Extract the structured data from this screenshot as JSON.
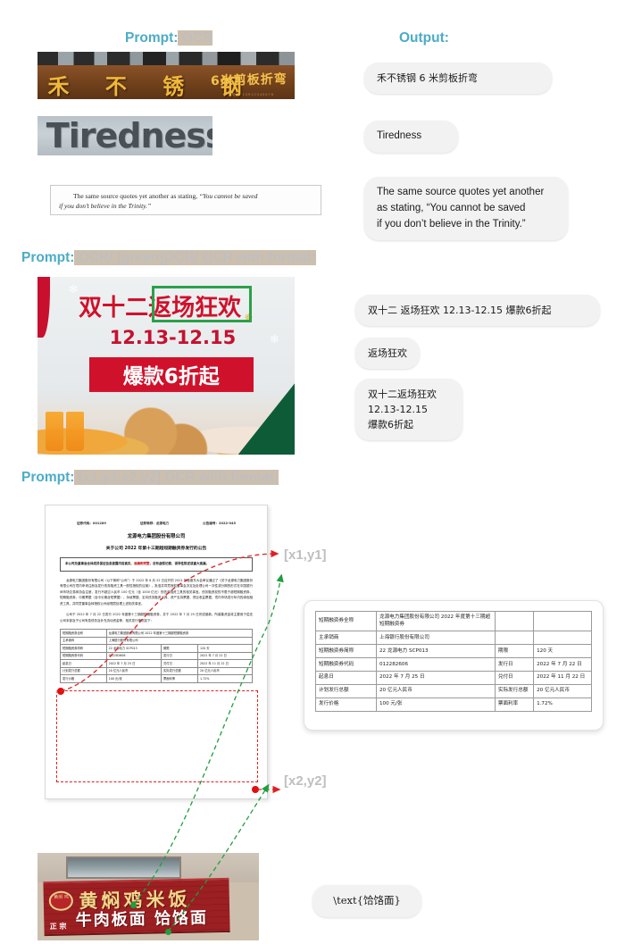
{
  "sections": [
    {
      "id": "section-1",
      "prompt_keyword": "Prompt:",
      "prompt_rest": " OCR",
      "output_heading": "Output:",
      "outputs": [
        {
          "text": "禾不锈钢 6 米剪板折弯"
        },
        {
          "text": "Tiredness"
        },
        {
          "text": "The same source quotes yet another\nas stating, “You cannot be saved\nif you don’t believe in the Trinity.”"
        }
      ],
      "images": [
        {
          "name": "stainless-steel-sign",
          "big_text": "禾 不 锈 钢",
          "small_text": "6米剪板折弯",
          "tiny_text": "电话 13912345678"
        },
        {
          "name": "tiredness-sign",
          "word": "Tiredness"
        },
        {
          "name": "scanned-paragraph",
          "line1_plain": "The same source quotes yet another as stating, ",
          "line1_italic": "“You cannot be saved",
          "line2_italic": "if you don’t believe in the Trinity.”"
        }
      ]
    },
    {
      "id": "section-2",
      "prompt_keyword": "Prompt:",
      "prompt_rest": " OCR/ [green]OCR/ OCR with format:",
      "outputs": [
        {
          "text": "双十二 返场狂欢 12.13-12.15 爆款6折起"
        },
        {
          "text": "返场狂欢"
        },
        {
          "text": "双十二返场狂欢\n12.13-12.15\n爆款6折起"
        }
      ],
      "promo": {
        "name": "kfc-promo-banner",
        "line1": "双十二返场狂欢",
        "line1_highlight": "返场狂欢",
        "line2": "12.13-12.15",
        "line3": "爆款6折起",
        "green_box_color": "#2aa14a",
        "red_color": "#d0112b"
      }
    },
    {
      "id": "section-3",
      "prompt_keyword": "Prompt:",
      "prompt_rest": " [x1,y1,x2,y2] OCR with format:",
      "coord_tag_1": "[x1,y1]",
      "coord_tag_2": "[x2,y2]",
      "document": {
        "name": "announcement-page",
        "meta": [
          "证券代码：001289",
          "证券简称：龙源电力",
          "公告编号：2022-045"
        ],
        "title": "龙源电力集团股份有限公司",
        "subtitle": "关于公司 2022 年第十三期超短期融资券发行的公告",
        "notice_line1": "本公司及董事会全体成员保证信息披露内容真实、",
        "notice_highlight": "准确和完整",
        "notice_line2": "，没有虚假记载、误导",
        "notice_line3": "性陈述或重大遗漏。",
        "paragraphs": [
          "龙源电力集团股份有限公司（以下简称“公司”）于 2022 年 6 月 22 日召开的 2021 年度股东大会审议通过了《关于龙源电力集团股份有限公司在境内申请注册及发行债务融资工具一般性授权的议案》，批准并同意授权董事会决定及处理公司一次性或分期的形式在中国银行间市场交易商协会注册、发行不超过人民币 100 亿元（含 1000 亿元）的债务融资工具的相关事宜。债务融资权的不限于超短期融资券、短期融资券、中期票据（含中长期含短票据）、永续票据、定向债务融资工具、资产支持票据、项目收益票据、境内市场发行年内的绿色融资工具，并同意董事会转授权公司经理层处理上述相关事宜。",
          "公司于 2022 年 7 月 22 日发行 2022 年度第十三期超短期融资券，并于 2022 年 7 月 25 日完成缴款。所募集资金将主要用于偿还公司本部及子公司有息债务及补充流动资金等，相关发行情况如下："
        ],
        "inner_table_caption": "短期融资券发行情况表"
      },
      "table_card": {
        "name": "extracted-table",
        "rows": [
          {
            "c1": "短期融资券全称",
            "c2": "龙源电力集团股份有限公司 2022 年度第十三期超短期融资券",
            "c3": "",
            "c4": ""
          },
          {
            "c1": "主承销商",
            "c2": "上海银行股份有限公司",
            "c3": "",
            "c4": ""
          },
          {
            "c1": "短期融资券简称",
            "c2": "22 龙源电力 SCP013",
            "c3": "期限",
            "c4": "120 天"
          },
          {
            "c1": "短期融资券代码",
            "c2": "012282606",
            "c3": "发行日",
            "c4": "2022 年 7 月 22 日"
          },
          {
            "c1": "起息日",
            "c2": "2022 年 7 月 25 日",
            "c3": "兑付日",
            "c4": "2022 年 11 月 22 日"
          },
          {
            "c1": "计划发行总额",
            "c2": "20 亿元人民币",
            "c3": "实际发行总额",
            "c4": "20 亿元人民币"
          },
          {
            "c1": "发行价格",
            "c2": "100 元/张",
            "c3": "票面利率",
            "c4": "1.72%"
          }
        ]
      },
      "restaurant_sign": {
        "name": "restaurant-signboard",
        "logo_text": "黄焖\n鸡",
        "line1": "黄焖鸡米饭",
        "badge": "正\n宗",
        "line2": "牛肉板面 饸饹面"
      },
      "restaurant_output": {
        "text": "\\text{饸饹面}"
      }
    }
  ],
  "colors": {
    "accent": "#4BACC6",
    "muted": "#BFBFBF",
    "bubble_bg": "#F2F2F2",
    "red_arrow": "#E02020",
    "green_arrow": "#1F9E3E"
  }
}
